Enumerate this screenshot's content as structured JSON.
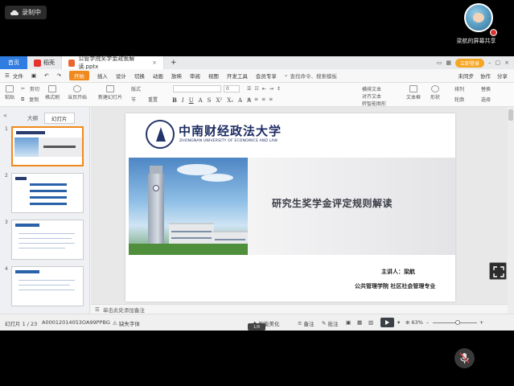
{
  "recording": {
    "label": "录制中"
  },
  "presenter": {
    "name": "梁航的屏幕共享"
  },
  "tabs": {
    "home": "首页",
    "shell": "稻壳",
    "document": "公管学院奖学金政策解读.pptx",
    "login": "立即登录"
  },
  "menu": {
    "file": "文件",
    "start": "开始",
    "items": [
      "插入",
      "设计",
      "切换",
      "动画",
      "放映",
      "审阅",
      "视图",
      "开发工具",
      "会员专享"
    ],
    "search": "查找命令、搜索模板",
    "sync": "未同步",
    "collab": "协作",
    "share": "分享"
  },
  "ribbon": {
    "paste": "粘贴",
    "cut": "剪切",
    "copy": "复制",
    "format_painter": "格式刷",
    "play_from_current": "当页开始",
    "new_slide": "新建幻灯片",
    "layout": "版式",
    "section": "节",
    "reset": "重置",
    "font_box_value": "0",
    "textbox": "文本框",
    "shapes": "形状",
    "arrange": "排列",
    "outline": "轮廓",
    "replace": "替换",
    "select": "选择",
    "text_box_type": "横排文本",
    "align_text": "对齐文本",
    "smartart": "转智能图形"
  },
  "panel": {
    "tab_outline": "大纲",
    "tab_slides": "幻灯片",
    "thumb_numbers": [
      "1",
      "2",
      "3",
      "4"
    ],
    "add": "+"
  },
  "slide": {
    "university_cn": "中南财经政法大学",
    "university_en": "ZHONGNAN UNIVERSITY OF ECONOMICS AND LAW",
    "title": "研究生奖学金评定规则解读",
    "speaker": "主讲人：梁航",
    "department": "公共管理学院  社区社会管理专业"
  },
  "notes": {
    "placeholder": "单击此处添加备注"
  },
  "status": {
    "slide_counter": "幻灯片 1 / 23",
    "doc_id": "A00012014053OA99PPBG",
    "missing_font": "缺失字体",
    "smart_beautify": "智能美化",
    "notes": "备注",
    "comments": "批注",
    "zoom": "63%",
    "page_indicator": "1/8"
  },
  "colors": {
    "brand_blue": "#2f7de1",
    "accent_orange": "#f08a1c",
    "university_navy": "#1e2d63"
  }
}
